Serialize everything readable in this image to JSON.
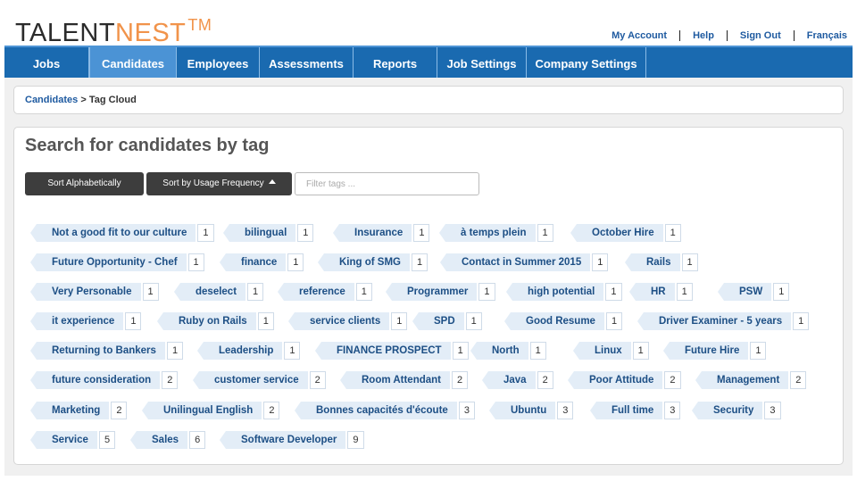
{
  "header": {
    "logo": {
      "part1": "TALENT",
      "part2": "NEST",
      "tm": "TM"
    },
    "links": [
      "My Account",
      "Help",
      "Sign Out",
      "Français"
    ]
  },
  "nav": {
    "items": [
      "Jobs",
      "Candidates",
      "Employees",
      "Assessments",
      "Reports",
      "Job Settings",
      "Company Settings"
    ],
    "active": "Candidates"
  },
  "breadcrumb": {
    "link": "Candidates",
    "sep": " > ",
    "current": "Tag Cloud"
  },
  "page": {
    "title": "Search for candidates by tag",
    "sort_alpha_label": "Sort Alphabetically",
    "sort_freq_label": "Sort by Usage Frequency",
    "filter_placeholder": "Filter tags ..."
  },
  "tags": [
    [
      {
        "label": "Not a good fit to our culture",
        "count": "1"
      },
      {
        "label": "bilingual",
        "count": "1"
      },
      {
        "label": "Insurance",
        "count": "1"
      },
      {
        "label": "à temps plein",
        "count": "1"
      },
      {
        "label": "October Hire",
        "count": "1"
      }
    ],
    [
      {
        "label": "Future Opportunity - Chef",
        "count": "1"
      },
      {
        "label": "finance",
        "count": "1"
      },
      {
        "label": "King of SMG",
        "count": "1"
      },
      {
        "label": "Contact in Summer 2015",
        "count": "1"
      },
      {
        "label": "Rails",
        "count": "1"
      }
    ],
    [
      {
        "label": "Very Personable",
        "count": "1"
      },
      {
        "label": "deselect",
        "count": "1"
      },
      {
        "label": "reference",
        "count": "1"
      },
      {
        "label": "Programmer",
        "count": "1"
      },
      {
        "label": "high potential",
        "count": "1"
      },
      {
        "label": "HR",
        "count": "1"
      },
      {
        "label": "PSW",
        "count": "1"
      }
    ],
    [
      {
        "label": "it experience",
        "count": "1"
      },
      {
        "label": "Ruby on Rails",
        "count": "1"
      },
      {
        "label": "service clients",
        "count": "1"
      },
      {
        "label": "SPD",
        "count": "1"
      },
      {
        "label": "Good Resume",
        "count": "1"
      },
      {
        "label": "Driver Examiner - 5 years",
        "count": "1"
      }
    ],
    [
      {
        "label": "Returning to Bankers",
        "count": "1"
      },
      {
        "label": "Leadership",
        "count": "1"
      },
      {
        "label": "FINANCE PROSPECT",
        "count": "1"
      },
      {
        "label": "North",
        "count": "1"
      },
      {
        "label": "Linux",
        "count": "1"
      },
      {
        "label": "Future Hire",
        "count": "1"
      }
    ],
    [
      {
        "label": "future consideration",
        "count": "2"
      },
      {
        "label": "customer service",
        "count": "2"
      },
      {
        "label": "Room Attendant",
        "count": "2"
      },
      {
        "label": "Java",
        "count": "2"
      },
      {
        "label": "Poor Attitude",
        "count": "2"
      },
      {
        "label": "Management",
        "count": "2"
      }
    ],
    [
      {
        "label": "Marketing",
        "count": "2"
      },
      {
        "label": "Unilingual English",
        "count": "2"
      },
      {
        "label": "Bonnes capacités d'écoute",
        "count": "3"
      },
      {
        "label": "Ubuntu",
        "count": "3"
      },
      {
        "label": "Full time",
        "count": "3"
      },
      {
        "label": "Security",
        "count": "3"
      }
    ],
    [
      {
        "label": "Service",
        "count": "5"
      },
      {
        "label": "Sales",
        "count": "6"
      },
      {
        "label": "Software Developer",
        "count": "9"
      }
    ]
  ]
}
